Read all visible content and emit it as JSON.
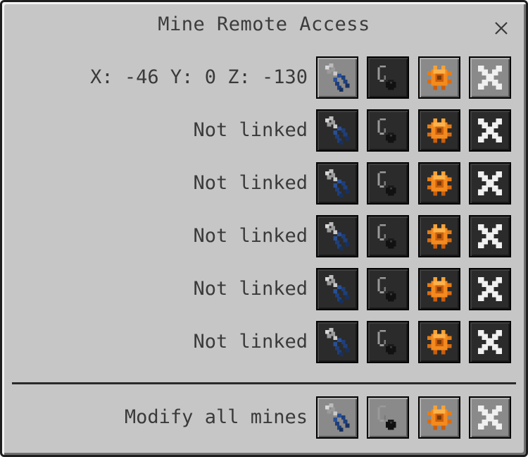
{
  "window": {
    "title": "Mine Remote Access",
    "close_icon": "close-icon"
  },
  "rows": [
    {
      "label": "X: -46 Y: 0 Z: -130",
      "linked": true,
      "modify_highlighted": true,
      "toggle_highlighted": false
    },
    {
      "label": "Not linked",
      "linked": false
    },
    {
      "label": "Not linked",
      "linked": false
    },
    {
      "label": "Not linked",
      "linked": false
    },
    {
      "label": "Not linked",
      "linked": false
    },
    {
      "label": "Not linked",
      "linked": false
    }
  ],
  "footer": {
    "label": "Modify all mines"
  },
  "buttons": {
    "icons": [
      "pliers-icon",
      "pickaxe-ore-icon",
      "gear-icon",
      "remove-x-icon"
    ]
  },
  "colors": {
    "panel": "#c6c6c6",
    "button_dark": "#2b2b2b",
    "button_light": "#8a8a8a",
    "gear_orange": "#f28a1f",
    "pliers_blue": "#1f3f7a"
  }
}
